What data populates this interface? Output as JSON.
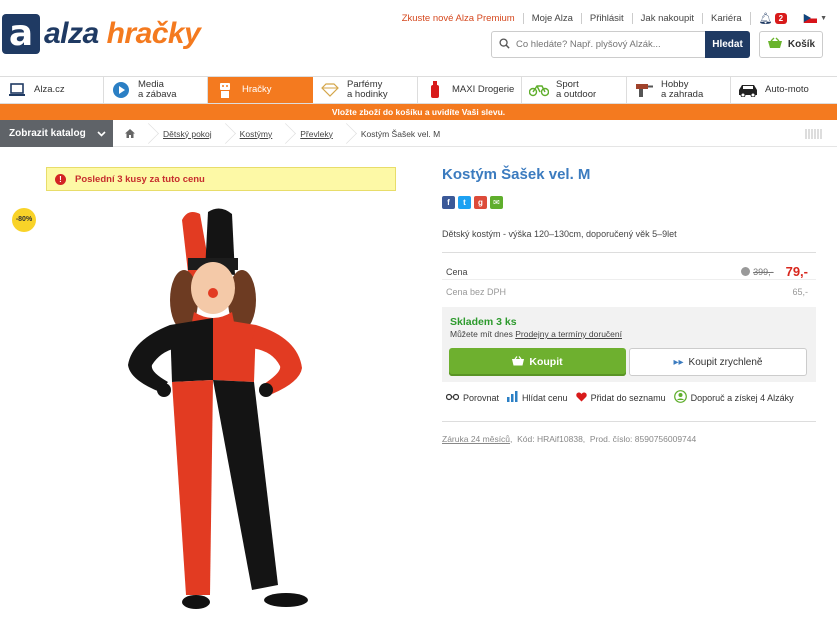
{
  "brand": {
    "alza": "alza",
    "hracky": "hračky",
    "logo_letter": "a"
  },
  "toplinks": [
    "Zkuste nové Alza Premium",
    "Moje Alza",
    "Přihlásit",
    "Jak nakoupit",
    "Kariéra"
  ],
  "notifications": "2",
  "search": {
    "placeholder": "Co hledáte? Např. plyšový Alzák...",
    "button": "Hledat"
  },
  "cart": {
    "label": "Košík"
  },
  "categories": [
    {
      "label1": "Alza.cz",
      "label2": "",
      "icon": "laptop-icon"
    },
    {
      "label1": "Media",
      "label2": "a zábava",
      "icon": "play-icon"
    },
    {
      "label1": "Hračky",
      "label2": "",
      "icon": "robot-icon"
    },
    {
      "label1": "Parfémy",
      "label2": "a hodinky",
      "icon": "diamond-icon"
    },
    {
      "label1": "MAXI Drogerie",
      "label2": "",
      "icon": "bottle-icon"
    },
    {
      "label1": "Sport",
      "label2": "a outdoor",
      "icon": "bike-icon"
    },
    {
      "label1": "Hobby",
      "label2": "a zahrada",
      "icon": "drill-icon"
    },
    {
      "label1": "Auto-moto",
      "label2": "",
      "icon": "car-icon"
    }
  ],
  "promo": "Vložte zboží do košíku a uvidíte Vaši slevu.",
  "catalog_button": "Zobrazit katalog",
  "breadcrumbs": [
    "Dětský pokoj",
    "Kostýmy",
    "Převleky",
    "Kostým Šašek vel. M"
  ],
  "warning": "Poslední 3 kusy za tuto cenu",
  "discount": "-80%",
  "product": {
    "title": "Kostým Šašek vel. M",
    "description": "Dětský kostým - výška 120–130cm, doporučený věk 5–9let",
    "price_label": "Cena",
    "old_price": "399,-",
    "price": "79,-",
    "price_novat_label": "Cena bez DPH",
    "price_novat": "65,-",
    "stock": "Skladem 3 ks",
    "stock_sub_prefix": "Můžete mít dnes",
    "stock_sub_link": "Prodejny a termíny doručení",
    "buy": "Koupit",
    "quick_buy": "Koupit zrychleně",
    "warranty": "Záruka 24 měsíců",
    "code": "Kód: HRAif10838,",
    "prod_number": "Prod. číslo: 8590756009744"
  },
  "actions": [
    "Porovnat",
    "Hlídat cenu",
    "Přidat do seznamu",
    "Doporuč a získej 4 Alzáky"
  ],
  "colors": {
    "orange": "#f47a1f",
    "navy": "#1f3a63",
    "green": "#6eb02f",
    "title_blue": "#3b7bbf",
    "price_red": "#d8261c"
  }
}
